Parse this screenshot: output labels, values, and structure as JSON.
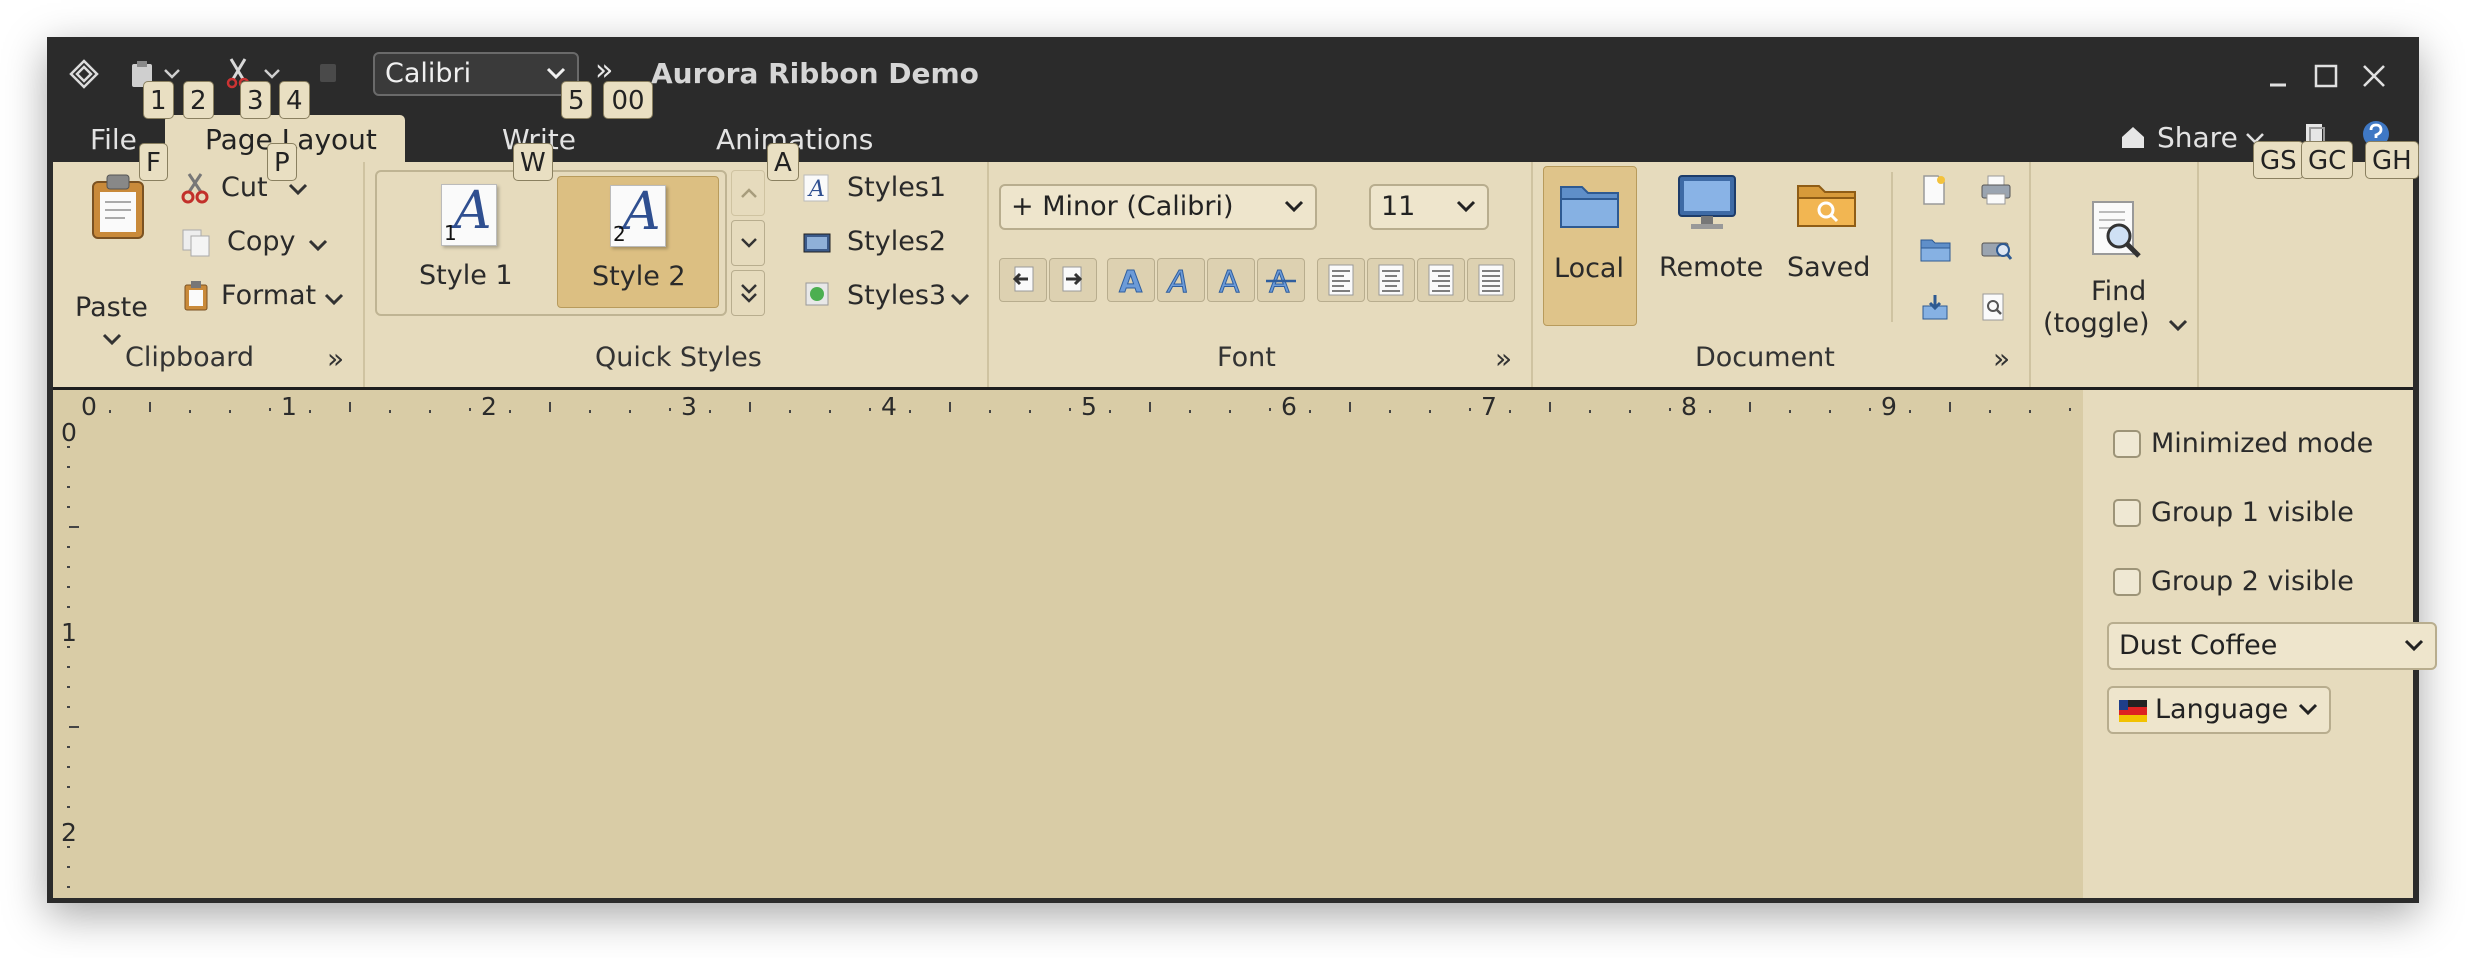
{
  "titlebar": {
    "title": "Aurora Ribbon Demo",
    "font_combo_value": "Calibri",
    "overflow_glyph": "»",
    "window_controls": [
      "minimize-icon",
      "maximize-icon",
      "close-icon"
    ]
  },
  "tabs": {
    "file": "File",
    "page_layout": "Page Layout",
    "write": "Write",
    "animations": "Animations",
    "share": "Share"
  },
  "keytips": {
    "k1": "1",
    "k2": "2",
    "k3": "3",
    "k4": "4",
    "k5": "5",
    "k00": "00",
    "F": "F",
    "P": "P",
    "W": "W",
    "A": "A",
    "GS": "GS",
    "GC": "GC",
    "GH": "GH"
  },
  "clipboard": {
    "paste": "Paste",
    "cut": "Cut",
    "copy": "Copy",
    "format": "Format",
    "group_label": "Clipboard"
  },
  "quick_styles": {
    "style1": "Style 1",
    "style2": "Style 2",
    "style1_badge": "1",
    "style2_badge": "2",
    "glyph": "A",
    "styles1": "Styles1",
    "styles2": "Styles2",
    "styles3": "Styles3",
    "group_label": "Quick Styles"
  },
  "font": {
    "family": "+ Minor (Calibri)",
    "size": "11",
    "group_label": "Font"
  },
  "document": {
    "local": "Local",
    "remote": "Remote",
    "saved": "Saved",
    "group_label": "Document"
  },
  "find": {
    "line1": "Find",
    "line2": "(toggle)"
  },
  "ruler": {
    "horizontal": [
      "0",
      "1",
      "2",
      "3",
      "4",
      "5",
      "6",
      "7",
      "8",
      "9"
    ],
    "vertical": [
      "0",
      "1",
      "2"
    ]
  },
  "panel": {
    "minimized_mode": "Minimized mode",
    "group1_visible": "Group 1 visible",
    "group2_visible": "Group 2 visible",
    "skin_value": "Dust Coffee",
    "language_value": "Language"
  },
  "colors": {
    "titlebar": "#2b2b2b",
    "ribbon": "#e6dbbd",
    "content": "#d9cca6",
    "selected_style": "#dcbf82",
    "local_button": "#dfc48a"
  }
}
